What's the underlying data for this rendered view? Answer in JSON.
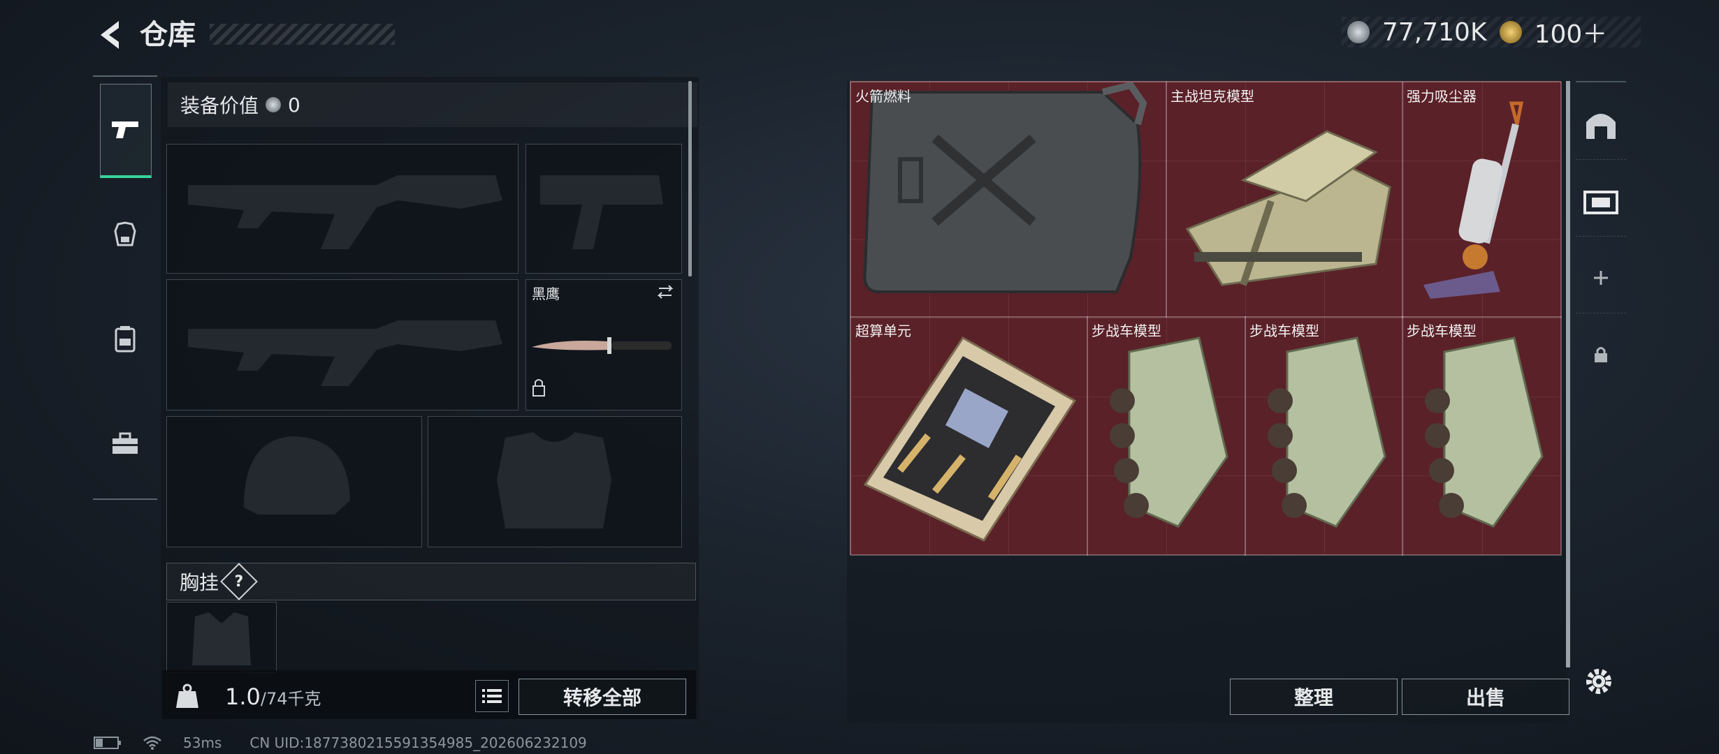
{
  "header": {
    "title": "仓库",
    "currency_main": "77,710K",
    "currency_secondary": "100＋"
  },
  "equipment": {
    "label": "装备价值",
    "value": "0",
    "knife_name": "黑鹰",
    "chest_label": "胸挂",
    "chest_help": "?"
  },
  "footer": {
    "weight_current": "1.0",
    "weight_max": "/74千克",
    "transfer_all": "转移全部"
  },
  "storage": {
    "items": [
      {
        "name": "火箭燃料",
        "icon": "jerry-can"
      },
      {
        "name": "主战坦克模型",
        "icon": "tank-model"
      },
      {
        "name": "强力吸尘器",
        "icon": "vacuum-cleaner"
      },
      {
        "name": "超算单元",
        "icon": "circuit-board"
      },
      {
        "name": "步战车模型",
        "icon": "ifv-model"
      },
      {
        "name": "步战车模型",
        "icon": "ifv-model"
      },
      {
        "name": "步战车模型",
        "icon": "ifv-model"
      }
    ],
    "organize": "整理",
    "sell": "出售"
  },
  "status_bar": {
    "ping": "53ms",
    "uid": "CN UID:1877380215591354985_202606232109"
  },
  "colors": {
    "accent_green": "#37d39a",
    "grid_bg": "#5a2128"
  }
}
